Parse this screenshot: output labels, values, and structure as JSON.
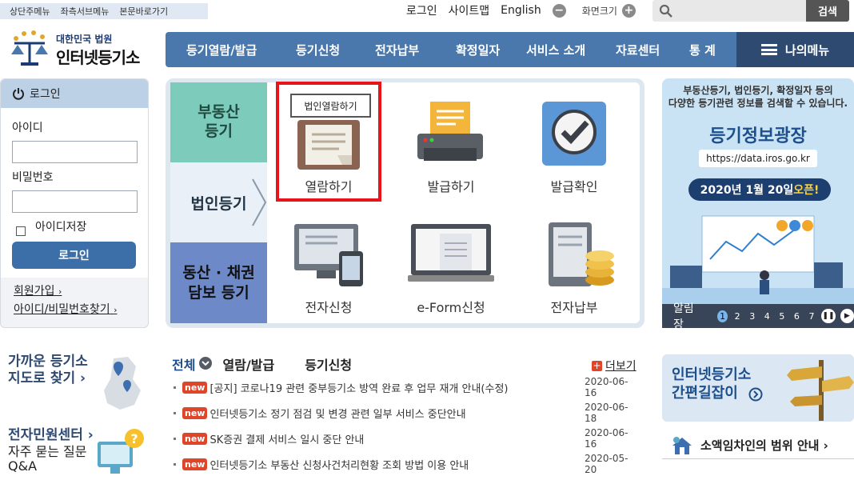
{
  "skip_links": [
    "상단주메뉴",
    "좌측서브메뉴",
    "본문바로가기"
  ],
  "top_links": {
    "login": "로그인",
    "sitemap": "사이트맵",
    "english": "English",
    "zoom_minus": "−",
    "zoom_label": "화면크기",
    "zoom_plus": "+"
  },
  "search": {
    "placeholder": "",
    "button": "검색"
  },
  "logo": {
    "sub": "대한민국 법원",
    "main": "인터넷등기소"
  },
  "nav": {
    "items": [
      "등기열람/발급",
      "등기신청",
      "전자납부",
      "확정일자",
      "서비스 소개",
      "자료센터",
      "통 계"
    ],
    "my_menu": "나의메뉴"
  },
  "login": {
    "title": "로그인",
    "id_label": "아이디",
    "pw_label": "비밀번호",
    "save_id": "아이디저장",
    "button": "로그인",
    "join": "회원가입",
    "find": "아이디/비밀번호찾기"
  },
  "service_tabs": {
    "realestate": "부동산 등기",
    "corporate": "법인등기",
    "movable": "동산 · 채권 담보 등기"
  },
  "services": {
    "view": "열람하기",
    "view_tooltip": "법인열람하기",
    "issue": "발급하기",
    "confirm": "발급확인",
    "e_apply": "전자신청",
    "eform": "e-Form신청",
    "e_pay": "전자납부"
  },
  "banner": {
    "top_line1": "부동산등기, 법인등기, 확정일자 등의",
    "top_line2": "다양한 등기관련 정보를 검색할 수 있습니다.",
    "title": "등기정보광장",
    "url": "https://data.iros.go.kr",
    "open_prefix": "2020년 1월 20일 ",
    "open_strong": "오픈!",
    "notice_label": "알림장",
    "pages": [
      "1",
      "2",
      "3",
      "4",
      "5",
      "6",
      "7"
    ],
    "pause_icon": "❚❚",
    "next_icon": "▶"
  },
  "nearby": {
    "line1": "가까운 등기소",
    "line2": "지도로 찾기 ›"
  },
  "minwon": {
    "title": "전자민원센터 ›",
    "faq1": "자주 묻는 질문",
    "faq2": "Q&A"
  },
  "news_tabs": {
    "all": "전체",
    "view": "열람/발급",
    "apply": "등기신청",
    "more": "더보기",
    "more_icon": "+"
  },
  "news": [
    {
      "badge": "new",
      "title": "[공지] 코로나19 관련 중부등기소 방역 완료 후 업무 재개 안내(수정)",
      "date": "2020-06-16"
    },
    {
      "badge": "new",
      "title": "인터넷등기소 정기 점검 및 변경 관련 일부 서비스 중단안내",
      "date": "2020-06-18"
    },
    {
      "badge": "new",
      "title": "SK증권 결제 서비스 일시 중단 안내",
      "date": "2020-06-16"
    },
    {
      "badge": "new",
      "title": "인터넷등기소 부동산 신청사건처리현황 조회 방법 이용 안내",
      "date": "2020-05-20"
    }
  ],
  "guide": {
    "line1": "인터넷등기소",
    "line2": "간편길잡이"
  },
  "lease": {
    "label": "소액임차인의 범위 안내 ›"
  },
  "colors": {
    "nav": "#4a78ac",
    "mymenu": "#2f4a70",
    "tab_realestate": "#7dcbbb",
    "tab_movable": "#6d89c8",
    "highlight": "#e8141b",
    "badge": "#e0452a"
  }
}
